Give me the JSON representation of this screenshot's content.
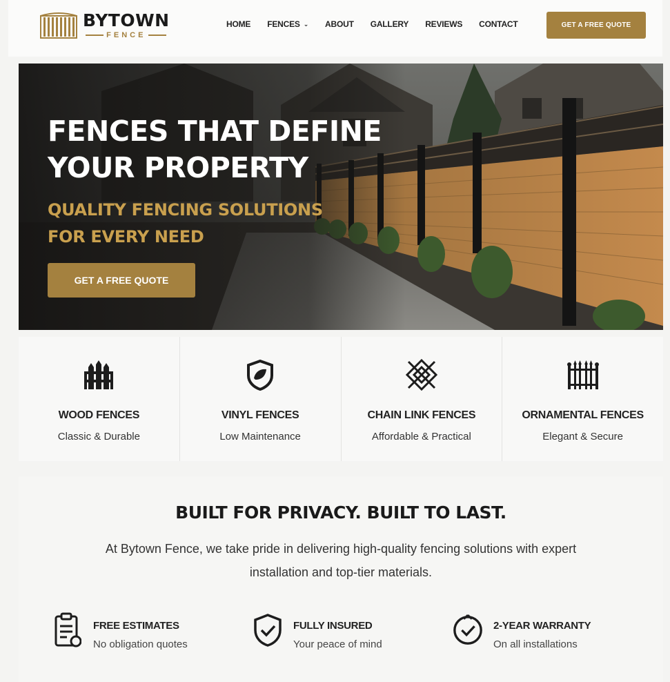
{
  "brand": {
    "name": "BYTOWN",
    "tagline": "FENCE",
    "accent_color": "#a4813f",
    "logo_icon": "fence-panel-icon"
  },
  "nav": {
    "items": [
      {
        "label": "HOME"
      },
      {
        "label": "FENCES",
        "has_dropdown": true
      },
      {
        "label": "ABOUT"
      },
      {
        "label": "GALLERY"
      },
      {
        "label": "REVIEWS"
      },
      {
        "label": "CONTACT"
      }
    ],
    "cta_label": "GET A FREE QUOTE"
  },
  "hero": {
    "title_line1": "FENCES THAT DEFINE",
    "title_line2": "YOUR PROPERTY",
    "subtitle_line1": "QUALITY FENCING SOLUTIONS",
    "subtitle_line2": "FOR EVERY NEED",
    "button_label": "GET A FREE QUOTE"
  },
  "categories": [
    {
      "title": "WOOD FENCES",
      "subtitle": "Classic & Durable",
      "icon": "wood-fence-icon"
    },
    {
      "title": "VINYL FENCES",
      "subtitle": "Low Maintenance",
      "icon": "shield-leaf-icon"
    },
    {
      "title": "CHAIN LINK FENCES",
      "subtitle": "Affordable & Practical",
      "icon": "chain-link-icon"
    },
    {
      "title": "ORNAMENTAL FENCES",
      "subtitle": "Elegant & Secure",
      "icon": "ornamental-fence-icon"
    }
  ],
  "about": {
    "title": "BUILT FOR PRIVACY. BUILT TO LAST.",
    "text": "At Bytown Fence, we take pride in delivering high-quality fencing solutions with expert installation and top-tier materials."
  },
  "features": [
    {
      "title": "FREE ESTIMATES",
      "subtitle": "No obligation quotes",
      "icon": "clipboard-icon"
    },
    {
      "title": "FULLY INSURED",
      "subtitle": "Your peace of mind",
      "icon": "shield-check-icon"
    },
    {
      "title": "2-YEAR WARRANTY",
      "subtitle": "On all installations",
      "icon": "badge-check-icon"
    }
  ]
}
